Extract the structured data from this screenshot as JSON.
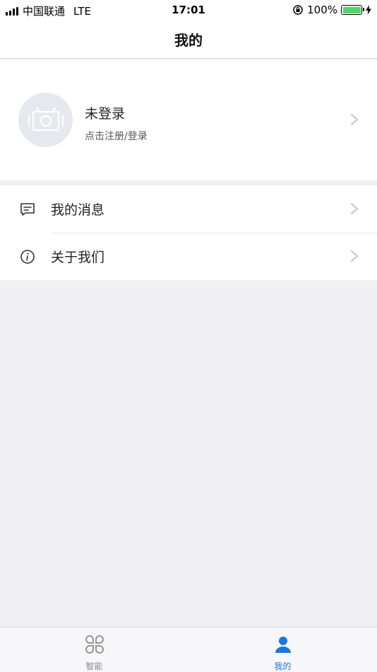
{
  "status_bar": {
    "carrier": "中国联通",
    "network": "LTE",
    "time": "17:01",
    "battery": "100%"
  },
  "header": {
    "title": "我的"
  },
  "profile": {
    "name": "未登录",
    "subtitle": "点击注册/登录"
  },
  "menu": {
    "items": [
      {
        "label": "我的消息",
        "icon": "message-icon"
      },
      {
        "label": "关于我们",
        "icon": "info-icon"
      }
    ]
  },
  "tab_bar": {
    "tabs": [
      {
        "label": "智能",
        "icon": "grid-icon",
        "active": false
      },
      {
        "label": "我的",
        "icon": "person-icon",
        "active": true
      }
    ],
    "active_color": "#1677e5",
    "inactive_color": "#888888"
  }
}
